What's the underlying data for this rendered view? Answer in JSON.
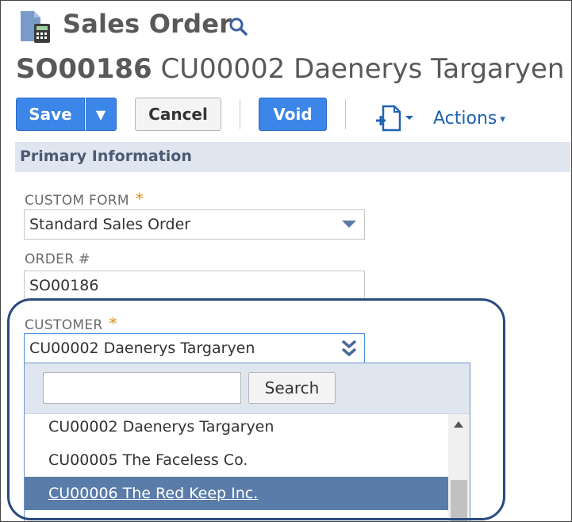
{
  "header": {
    "page_title": "Sales Order",
    "record_number": "SO00186",
    "record_customer": "CU00002 Daenerys Targaryen",
    "icons": [
      "sales-order-icon",
      "search-icon"
    ]
  },
  "toolbar": {
    "save_label": "Save",
    "save_menu_glyph": "▼",
    "cancel_label": "Cancel",
    "void_label": "Void",
    "actions_label": "Actions",
    "actions_caret": "▾"
  },
  "section": {
    "title": "Primary Information"
  },
  "fields": {
    "custom_form": {
      "label": "CUSTOM FORM",
      "required_mark": "*",
      "value": "Standard Sales Order"
    },
    "order_number": {
      "label": "ORDER #",
      "value": "SO00186"
    },
    "customer": {
      "label": "CUSTOMER",
      "required_mark": "*",
      "value": "CU00002 Daenerys Targaryen"
    }
  },
  "customer_dropdown": {
    "search_value": "",
    "search_button": "Search",
    "options": [
      {
        "label": "CU00002 Daenerys Targaryen",
        "selected": false
      },
      {
        "label": "CU00005 The Faceless Co.",
        "selected": false
      },
      {
        "label": "CU00006 The Red Keep Inc.",
        "selected": true
      }
    ]
  },
  "colors": {
    "primary_button": "#3b86e8",
    "link": "#1f62b3",
    "section_bar": "#e0e6ef",
    "required": "#e38c15",
    "selected_row": "#5a7ca8",
    "highlight_border": "#2a4a7f"
  }
}
